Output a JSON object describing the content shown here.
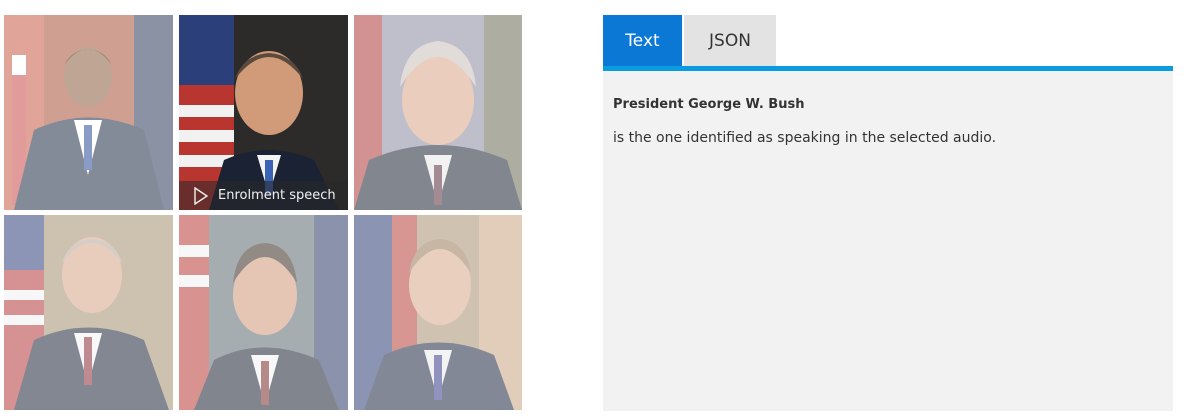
{
  "gallery": {
    "tiles": [
      {
        "label": "portrait-1"
      },
      {
        "label": "portrait-2"
      },
      {
        "label": "portrait-3"
      },
      {
        "label": "portrait-4"
      },
      {
        "label": "portrait-5"
      },
      {
        "label": "portrait-6"
      }
    ],
    "selected_overlay": {
      "icon": "play-icon",
      "label": "Enrolment speech"
    }
  },
  "tabs": {
    "active": "Text",
    "inactive": "JSON"
  },
  "result": {
    "title": "President George W. Bush",
    "description": "is the one identified as speaking in the selected audio."
  },
  "colors": {
    "tab_active": "#0a78d4",
    "tab_rule": "#0a9ce0",
    "panel_bg": "#f2f2f2"
  }
}
